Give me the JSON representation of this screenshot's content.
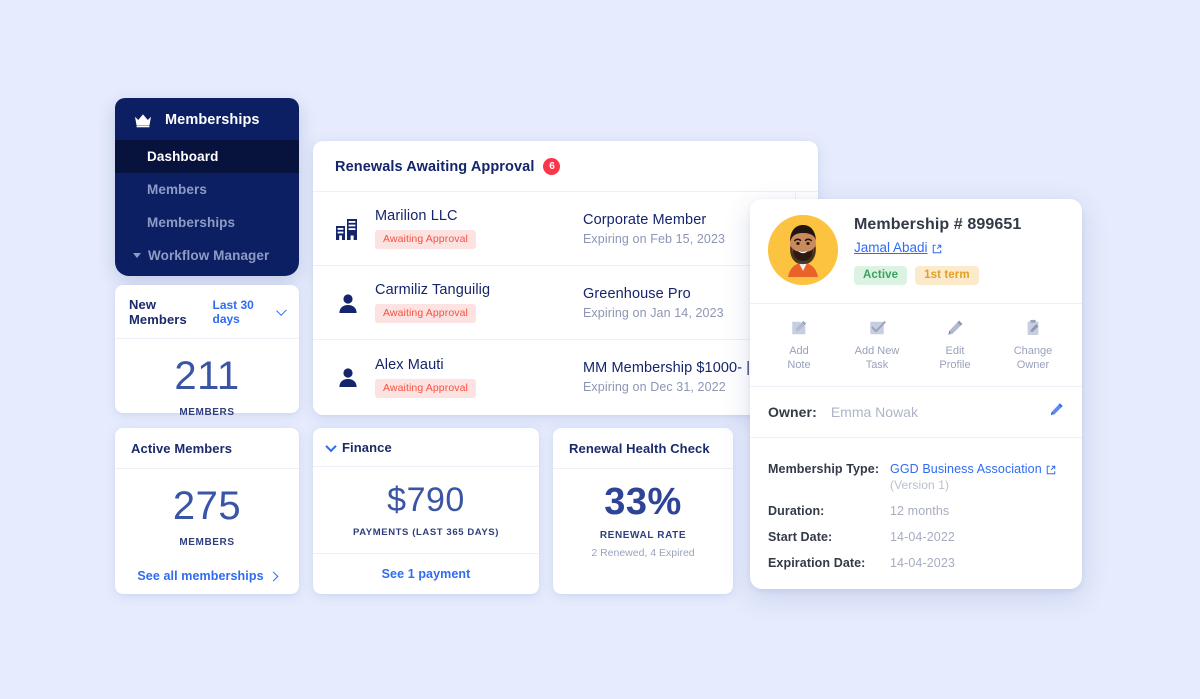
{
  "sidebar": {
    "brand": "Memberships",
    "brand_icon": "crown-icon",
    "items": [
      {
        "label": "Dashboard",
        "active": true
      },
      {
        "label": "Members",
        "active": false
      },
      {
        "label": "Memberships",
        "active": false
      },
      {
        "label": "Workflow Manager",
        "active": false,
        "caret": "caret-down-icon"
      }
    ]
  },
  "new_members_card": {
    "title": "New Members",
    "range": "Last 30 days",
    "range_icon": "chevron-down-icon",
    "value": "211",
    "unit": "MEMBERS"
  },
  "active_members_card": {
    "title": "Active Members",
    "value": "275",
    "unit": "MEMBERS",
    "link": "See all memberships",
    "link_icon": "chevron-right-icon"
  },
  "finance_card": {
    "title": "Finance",
    "collapse_icon": "chevron-down-icon",
    "value": "$790",
    "unit": "PAYMENTS (LAST 365 DAYS)",
    "link": "See 1 payment"
  },
  "renewal_health_card": {
    "title": "Renewal Health Check",
    "value": "33%",
    "unit": "RENEWAL RATE",
    "sub": "2 Renewed, 4 Expired"
  },
  "renewals_panel": {
    "title": "Renewals Awaiting Approval",
    "count": "6",
    "rows": [
      {
        "icon": "building-icon",
        "name": "Marilion LLC",
        "status": "Awaiting Approval",
        "plan": "Corporate Member",
        "expiry": "Expiring on Feb 15, 2023"
      },
      {
        "icon": "person-icon",
        "name": "Carmiliz Tanguilig",
        "status": "Awaiting Approval",
        "plan": "Greenhouse Pro",
        "expiry": "Expiring on Jan 14, 2023"
      },
      {
        "icon": "person-icon",
        "name": "Alex Mauti",
        "status": "Awaiting Approval",
        "plan": "MM Membership $1000- |",
        "expiry": "Expiring on Dec 31, 2022"
      }
    ]
  },
  "detail_card": {
    "avatar": "member-photo-avatar",
    "title": "Membership # 899651",
    "person": "Jamal Abadi",
    "person_link_icon": "external-link-icon",
    "tags": [
      {
        "label": "Active",
        "kind": "active"
      },
      {
        "label": "1st term",
        "kind": "term"
      }
    ],
    "actions": [
      {
        "icon": "add-note-icon",
        "line1": "Add",
        "line2": "Note"
      },
      {
        "icon": "check-square-icon",
        "line1": "Add New",
        "line2": "Task"
      },
      {
        "icon": "pencil-icon",
        "line1": "Edit",
        "line2": "Profile"
      },
      {
        "icon": "clipboard-icon",
        "line1": "Change",
        "line2": "Owner"
      }
    ],
    "owner_label": "Owner:",
    "owner_value": "Emma Nowak",
    "owner_edit_icon": "pencil-icon",
    "fields": [
      {
        "key": "Membership Type:",
        "value": "GGD Business Association",
        "link": true,
        "link_icon": "external-link-icon",
        "sub": "(Version 1)"
      },
      {
        "key": "Duration:",
        "value": "12 months"
      },
      {
        "key": "Start Date:",
        "value": "14-04-2022"
      },
      {
        "key": "Expiration Date:",
        "value": "14-04-2023"
      }
    ]
  },
  "colors": {
    "background": "#e6ecfd",
    "sidebar": "#0d1f63",
    "sidebar_active": "#07123d",
    "accent_blue": "#2f6bf3",
    "navy_text": "#15256b",
    "badge_red": "#f8384a",
    "pill_bg": "#fde2e2",
    "pill_text": "#f5523e",
    "tag_active_bg": "#dcf3e3",
    "tag_active_text": "#3aa35f",
    "tag_term_bg": "#fdeacb",
    "tag_term_text": "#e0a02a",
    "avatar_bg": "#fbc340"
  }
}
